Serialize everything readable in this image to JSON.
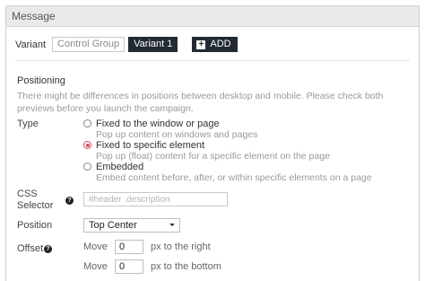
{
  "panel": {
    "title": "Message"
  },
  "variants": {
    "label": "Variant",
    "items": [
      {
        "label": "Control Group",
        "active": false
      },
      {
        "label": "Variant 1",
        "active": true
      }
    ],
    "add_label": "ADD"
  },
  "positioning": {
    "title": "Positioning",
    "description": "There might be differences in positions between desktop and mobile. Please check both previews before you launch the campaign.",
    "type_label": "Type",
    "options": [
      {
        "title": "Fixed to the window or page",
        "desc": "Pop up content on windows and pages",
        "checked": false
      },
      {
        "title": "Fixed to specific element",
        "desc": "Pop up (float) content for a specific element on the page",
        "checked": true
      },
      {
        "title": "Embedded",
        "desc": "Embed content before, after, or within specific elements on a page",
        "checked": false
      }
    ],
    "css_selector_label_1": "CSS",
    "css_selector_label_2": "Selector",
    "css_selector_placeholder": "#header .description",
    "css_selector_value": "",
    "position_label": "Position",
    "position_value": "Top Center",
    "offset_label": "Offset",
    "offset_x": {
      "move_label": "Move",
      "value": "0",
      "unit": "px to the right"
    },
    "offset_y": {
      "move_label": "Move",
      "value": "0",
      "unit": "px to the bottom"
    }
  },
  "colors": {
    "accent": "#e0455e",
    "dark_button": "#222a33",
    "header_bg": "#e9e9e9"
  }
}
